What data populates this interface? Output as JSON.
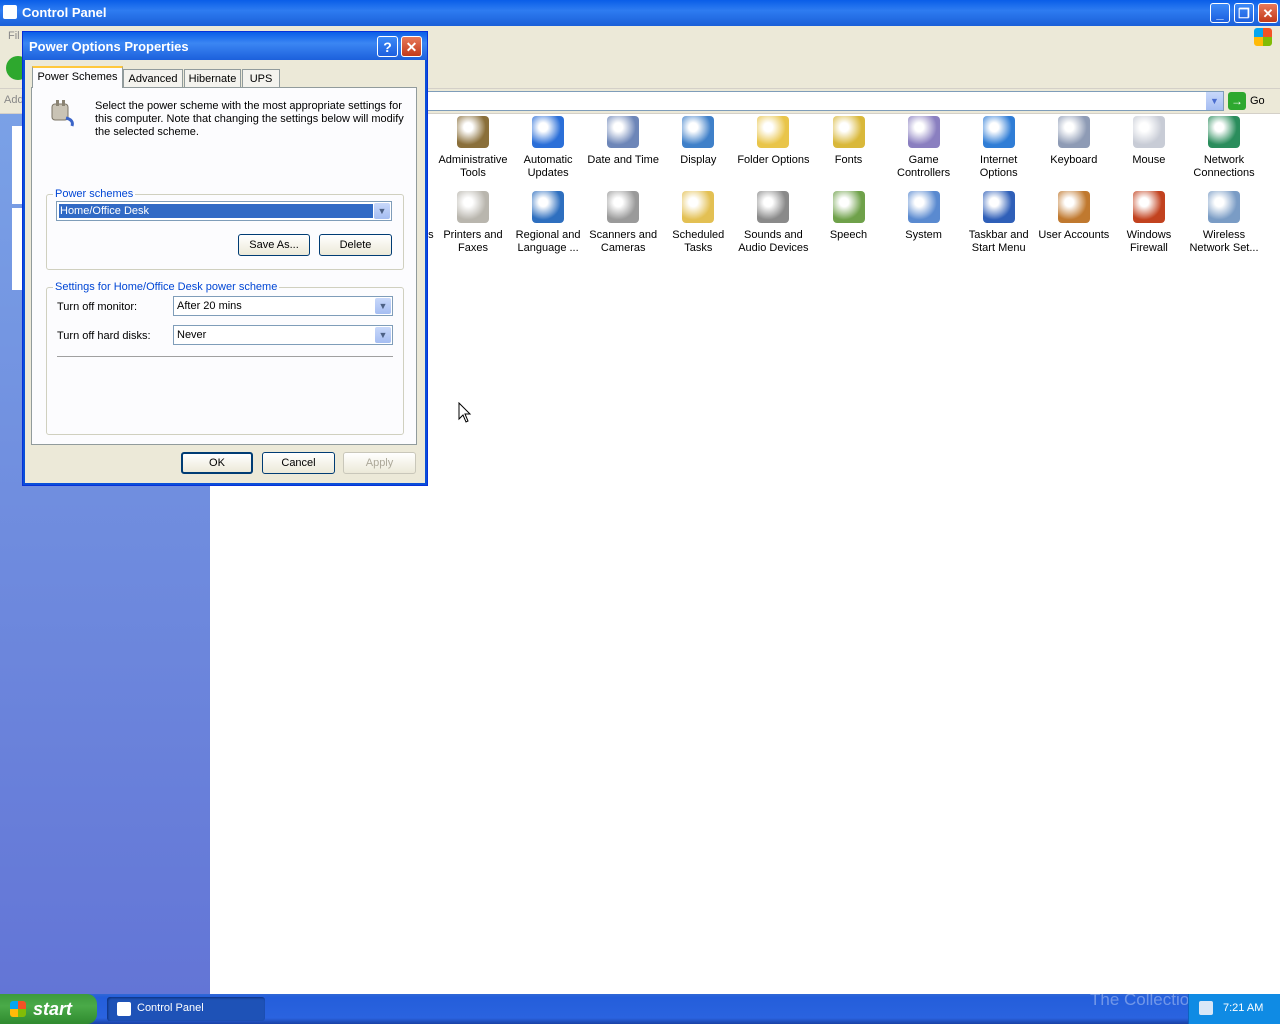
{
  "main_window": {
    "title": "Control Panel",
    "menu_partial": "Fil",
    "address_label_partial": "Add",
    "go_label": "Go",
    "minimize_icon": "minimize-icon",
    "restore_icon": "restore-icon",
    "close_icon": "close-icon"
  },
  "content_items": {
    "row1": [
      {
        "label": "Administrative Tools",
        "icon": "admin-tools-icon",
        "color": "#8a6f3a"
      },
      {
        "label": "Automatic Updates",
        "icon": "windows-globe-icon",
        "color": "#2b6fd8"
      },
      {
        "label": "Date and Time",
        "icon": "clock-calendar-icon",
        "color": "#6d86b8"
      },
      {
        "label": "Display",
        "icon": "monitor-icon",
        "color": "#3f80c9"
      },
      {
        "label": "Folder Options",
        "icon": "folder-check-icon",
        "color": "#e9c54a"
      },
      {
        "label": "Fonts",
        "icon": "fonts-folder-icon",
        "color": "#d9b83a"
      },
      {
        "label": "Game Controllers",
        "icon": "gamepad-icon",
        "color": "#8a7fc0"
      },
      {
        "label": "Internet Options",
        "icon": "internet-globe-icon",
        "color": "#2f7dd6"
      },
      {
        "label": "Keyboard",
        "icon": "keyboard-icon",
        "color": "#8e9bb5"
      },
      {
        "label": "Mouse",
        "icon": "mouse-icon",
        "color": "#c8ccd6"
      },
      {
        "label": "Network Connections",
        "icon": "network-globe-icon",
        "color": "#2a8d5c"
      }
    ],
    "row2": [
      {
        "label": "Printers and Faxes",
        "icon": "printer-icon",
        "color": "#b9b6ae"
      },
      {
        "label": "Regional and Language ...",
        "icon": "regional-globe-icon",
        "color": "#2e6fbf"
      },
      {
        "label": "Scanners and Cameras",
        "icon": "scanner-camera-icon",
        "color": "#9a9a9a"
      },
      {
        "label": "Scheduled Tasks",
        "icon": "scheduled-folder-icon",
        "color": "#e3c053"
      },
      {
        "label": "Sounds and Audio Devices",
        "icon": "speaker-icon",
        "color": "#8a8a8a"
      },
      {
        "label": "Speech",
        "icon": "speech-icon",
        "color": "#6fa14a"
      },
      {
        "label": "System",
        "icon": "system-computer-icon",
        "color": "#5a8ad0"
      },
      {
        "label": "Taskbar and Start Menu",
        "icon": "taskbar-icon",
        "color": "#2f5fb8"
      },
      {
        "label": "User Accounts",
        "icon": "users-icon",
        "color": "#c0792f"
      },
      {
        "label": "Windows Firewall",
        "icon": "firewall-brick-icon",
        "color": "#c2421f"
      },
      {
        "label": "Wireless Network Set...",
        "icon": "wireless-icon",
        "color": "#7a9cc5"
      }
    ],
    "partial_label": "ns"
  },
  "dialog": {
    "title": "Power Options Properties",
    "help_label": "?",
    "close_label": "✕",
    "tabs": [
      "Power Schemes",
      "Advanced",
      "Hibernate",
      "UPS"
    ],
    "active_tab": "Power Schemes",
    "description": "Select the power scheme with the most appropriate settings for this computer. Note that changing the settings below will modify the selected scheme.",
    "power_schemes_legend": "Power schemes",
    "selected_scheme": "Home/Office Desk",
    "save_as_label": "Save As...",
    "delete_label": "Delete",
    "settings_legend": "Settings for Home/Office Desk power scheme",
    "monitor_label": "Turn off monitor:",
    "monitor_value": "After 20 mins",
    "disks_label": "Turn off hard disks:",
    "disks_value": "Never",
    "ok_label": "OK",
    "cancel_label": "Cancel",
    "apply_label": "Apply"
  },
  "taskbar": {
    "start_label": "start",
    "task_label": "Control Panel",
    "clock": "7:21 AM",
    "watermark": "The Collection Book"
  }
}
